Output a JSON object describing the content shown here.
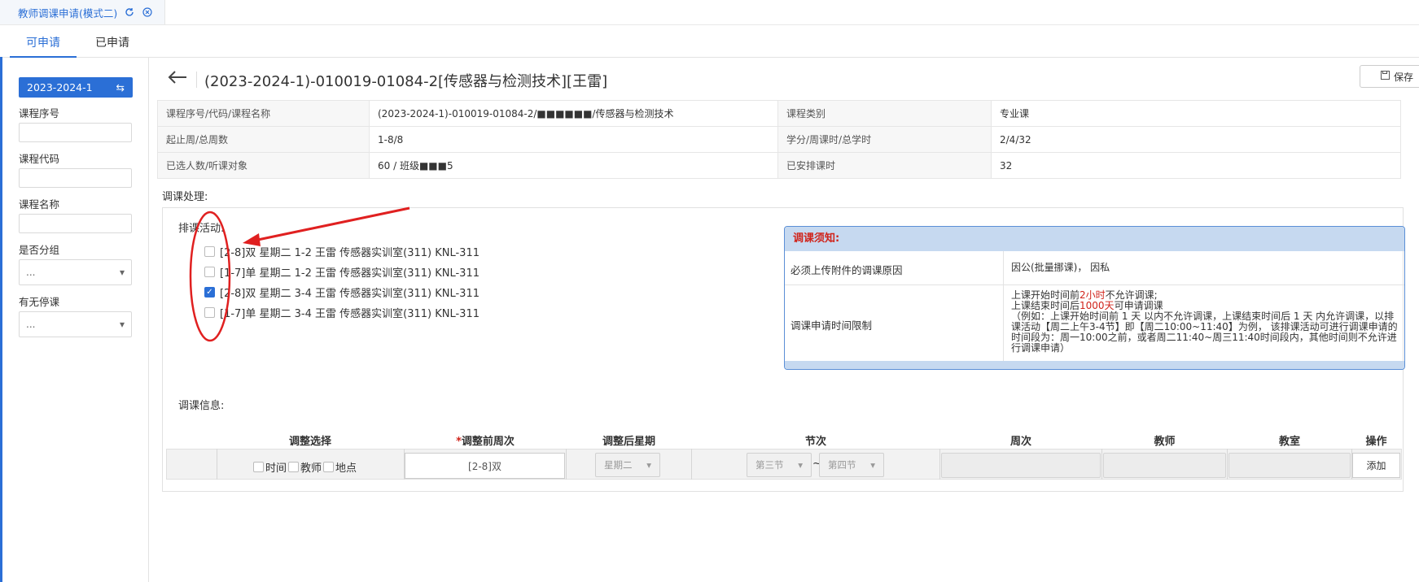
{
  "top_tab": {
    "title": "教师调课申请(模式二)"
  },
  "tabs": [
    {
      "label": "可申请"
    },
    {
      "label": "已申请"
    }
  ],
  "sidebar": {
    "year": "2023-2024-1",
    "fields": [
      {
        "label": "课程序号"
      },
      {
        "label": "课程代码"
      },
      {
        "label": "课程名称"
      },
      {
        "label": "是否分组",
        "value": "..."
      },
      {
        "label": "有无停课",
        "value": "..."
      }
    ]
  },
  "header": {
    "title": "(2023-2024-1)-010019-01084-2[传感器与检测技术][王雷]",
    "save_label": "保存"
  },
  "info": {
    "row1": {
      "k1": "课程序号/代码/课程名称",
      "v1": "(2023-2024-1)-010019-01084-2/■■■■■■/传感器与检测技术",
      "k2": "课程类别",
      "v2": "专业课"
    },
    "row2": {
      "k1": "起止周/总周数",
      "v1": "1-8/8",
      "k2": "学分/周课时/总学时",
      "v2": "2/4/32"
    },
    "row3": {
      "k1": "已选人数/听课对象",
      "v1": "60 / 班级■■■5",
      "k2": "已安排课时",
      "v2": "32"
    }
  },
  "process": {
    "title": "调课处理:",
    "activities_label": "排课活动:",
    "activities": [
      {
        "text": "[2-8]双 星期二 1-2 王雷 传感器实训室(311) KNL-311",
        "checked": false
      },
      {
        "text": "[1-7]单 星期二 1-2 王雷 传感器实训室(311) KNL-311",
        "checked": false
      },
      {
        "text": "[2-8]双 星期二 3-4 王雷 传感器实训室(311) KNL-311",
        "checked": true
      },
      {
        "text": "[1-7]单 星期二 3-4 王雷 传感器实训室(311) KNL-311",
        "checked": false
      }
    ]
  },
  "notice": {
    "title": "调课须知:",
    "reason_key": "必须上传附件的调课原因",
    "reason_value": "因公(批量挪课)， 因私",
    "time_key": "调课申请时间限制",
    "t1_a": "上课开始时间前",
    "t1_b": "2小时",
    "t1_c": "不允许调课;",
    "t2_a": "上课结束时间后",
    "t2_b": "1000天",
    "t2_c": "可申请调课",
    "t3": "（例如：上课开始时间前 1 天 以内不允许调课，上课结束时间后 1 天 内允许调课，以排课活动【周二上午3-4节】即【周二10:00~11:40】为例， 该排课活动可进行调课申请的时间段为：周一10:00之前，或者周二11:40~周三11:40时间段内，其他时间则不允许进行调课申请）"
  },
  "adjust": {
    "title": "调课信息:",
    "headers": {
      "select": "调整选择",
      "required_mark": "*",
      "before_week": "调整前周次",
      "after_day": "调整后星期",
      "section": "节次",
      "weeks": "周次",
      "teacher": "教师",
      "room": "教室",
      "op": "操作"
    },
    "opt_time": "时间",
    "opt_teacher": "教师",
    "opt_place": "地点",
    "before_week_value": "[2-8]双",
    "after_day_value": "星期二",
    "section_from": "第三节",
    "section_tilde": "~",
    "section_to": "第四节",
    "add_label": "添加"
  },
  "colors": {
    "accent": "#2b6fd6",
    "annotation": "#e02020",
    "notice_header": "#c6d9f0"
  }
}
